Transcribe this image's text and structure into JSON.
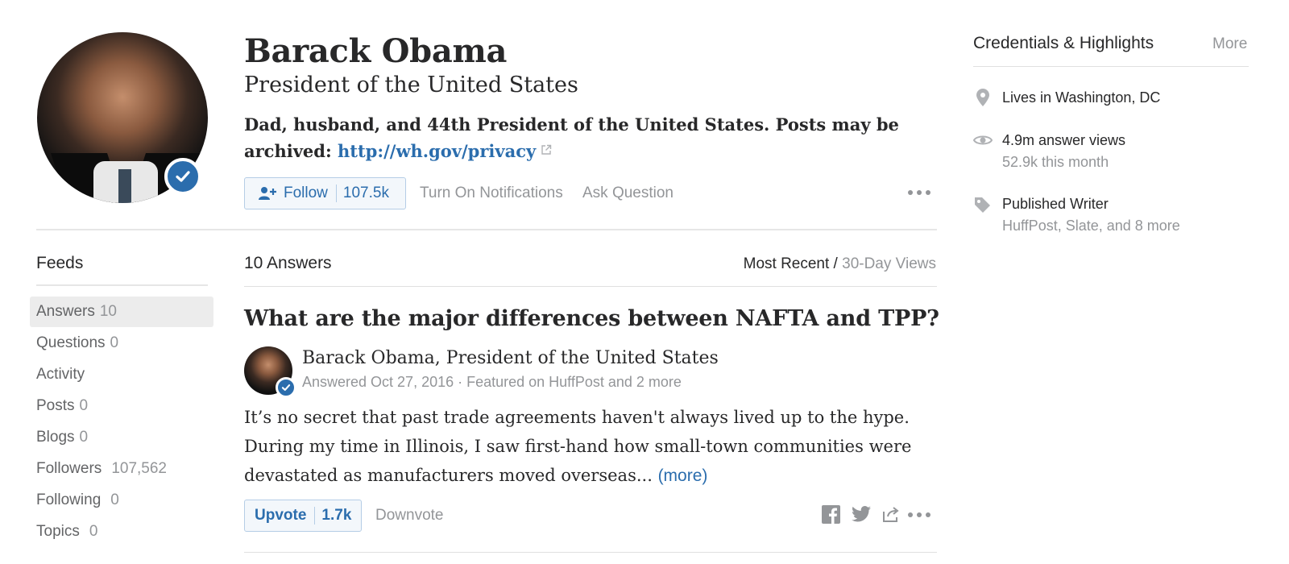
{
  "profile": {
    "name": "Barack Obama",
    "title": "President of the United States",
    "bio_text": "Dad, husband, and 44th President of the United States. Posts may be archived:",
    "bio_link": "http://wh.gov/privacy",
    "follow_label": "Follow",
    "follower_count": "107.5k",
    "notifications_label": "Turn On Notifications",
    "ask_label": "Ask Question"
  },
  "sidebar": {
    "title": "Feeds",
    "items": [
      {
        "label": "Answers",
        "count": "10"
      },
      {
        "label": "Questions",
        "count": "0"
      },
      {
        "label": "Activity",
        "count": ""
      },
      {
        "label": "Posts",
        "count": "0"
      },
      {
        "label": "Blogs",
        "count": "0"
      },
      {
        "label": "Followers",
        "count": "107,562"
      },
      {
        "label": "Following",
        "count": "0"
      },
      {
        "label": "Topics",
        "count": "0"
      }
    ]
  },
  "main": {
    "answers_heading": "10 Answers",
    "sort_active": "Most Recent",
    "sort_separator": " / ",
    "sort_alt": "30-Day Views",
    "answer": {
      "question": "What are the major differences between NAFTA and TPP?",
      "author": "Barack Obama, President of the United States",
      "meta": "Answered Oct 27, 2016 · Featured on HuffPost and 2 more",
      "excerpt": "It’s no secret that past trade agreements haven't always lived up to the hype. During my time in Illinois, I saw first-hand how small-town communities were devastated as manufacturers moved overseas...",
      "more_label": "(more)",
      "upvote_label": "Upvote",
      "upvote_count": "1.7k",
      "downvote_label": "Downvote"
    }
  },
  "credentials": {
    "title": "Credentials & Highlights",
    "more_label": "More",
    "location": "Lives in Washington, DC",
    "views": "4.9m answer views",
    "views_sub": "52.9k this month",
    "writer": "Published Writer",
    "writer_sub": "HuffPost, Slate, and 8 more"
  },
  "colors": {
    "accent": "#2b6dad",
    "muted": "#939598",
    "text": "#282829"
  },
  "icons": [
    "verified-badge-icon",
    "external-link-icon",
    "add-user-icon",
    "more-dots-icon",
    "location-pin-icon",
    "eye-icon",
    "tag-icon",
    "facebook-icon",
    "twitter-icon",
    "share-icon"
  ]
}
